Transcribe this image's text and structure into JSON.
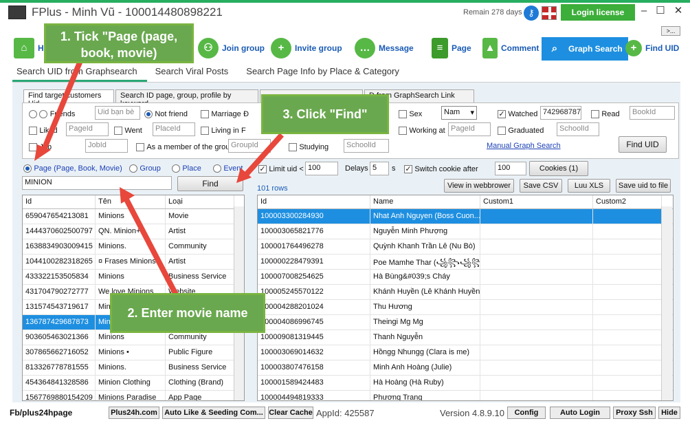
{
  "app": {
    "title": "FPlus - Minh Vũ - 100014480898221",
    "remain": "Remain 278 days",
    "login_label": "Login license",
    "expand_label": ">..."
  },
  "nav": [
    {
      "label": "H",
      "icon": "home-icon"
    },
    {
      "label": "Join group",
      "icon": "group-icon"
    },
    {
      "label": "Invite group",
      "icon": "invite-icon"
    },
    {
      "label": "Message",
      "icon": "message-icon"
    },
    {
      "label": "Page",
      "icon": "page-icon"
    },
    {
      "label": "Comment",
      "icon": "comment-icon"
    },
    {
      "label": "Graph Search",
      "icon": "search-icon"
    },
    {
      "label": "Find UID",
      "icon": "find-uid-icon"
    }
  ],
  "subtabs": [
    "Search UID from Graphsearch",
    "Search Viral Posts",
    "Search Page Info by Place & Category"
  ],
  "inner_tabs": [
    "Find target customers Uid",
    "Search ID page, group, profile by keyword",
    "",
    "D from GraphSearch Link"
  ],
  "options": {
    "friends": "Friends",
    "friends_input": "Uid bạn bè",
    "not_friend": "Not friend",
    "marriage": "Marriage",
    "marriage_prefix": "Đ",
    "sex": "Sex",
    "sex_value": "Nam",
    "watched": "Watched",
    "watched_input": "7429687873",
    "read": "Read",
    "read_input": "BookId",
    "liked": "Liked",
    "liked_input": "PageId",
    "went": "Went",
    "went_input": "PlaceId",
    "living": "Living in",
    "living_prefix": "F",
    "working": "Working at",
    "working_input": "PageId",
    "graduated": "Graduated",
    "graduated_input": "SchoolId",
    "job": "Job",
    "job_input": "JobId",
    "member": "As a member of the group",
    "member_input": "GroupId",
    "studying": "Studying",
    "studying_input": "SchoolId",
    "manual_link": "Manual Graph Search",
    "find_uid_btn": "Find UID"
  },
  "search": {
    "page_radio": "Page (Page, Book, Movie)",
    "group_radio": "Group",
    "place_radio": "Place",
    "event_radio": "Event",
    "keyword": "MINION",
    "find_btn": "Find"
  },
  "controls": {
    "limit_label": "Limit uid <",
    "limit": "100",
    "delays_label": "Delays",
    "delays": "5",
    "delays_unit": "s",
    "switch_label": "Switch cookie after",
    "switch": "100",
    "cookies_btn": "Cookies (1)",
    "rows": "101 rows",
    "view_btn": "View in webbrower",
    "savecsv_btn": "Save CSV",
    "luuxls_btn": "Luu XLS",
    "saveuid_btn": "Save uid to file"
  },
  "left_table": {
    "headers": [
      "Id",
      "Tên",
      "Loại"
    ],
    "rows": [
      [
        "659047654213081",
        "Minions",
        "Movie"
      ],
      [
        "1444370602500797",
        "QN. Minion+",
        "Artist"
      ],
      [
        "1638834903009415",
        "Minions.",
        "Community"
      ],
      [
        "1044100282318265",
        "¤ Frases Minions",
        "Artist"
      ],
      [
        "433322153505834",
        "Minions",
        "Business Service"
      ],
      [
        "431704790272777",
        "We love Minions",
        "Website"
      ],
      [
        "131574543719617",
        "Mini",
        "Community"
      ],
      [
        "136787429687873",
        "Mini",
        "Movie"
      ],
      [
        "903605463021366",
        "Minions",
        "Community"
      ],
      [
        "307865662716052",
        "Minions •",
        "Public Figure"
      ],
      [
        "813326778781555",
        "Minions.",
        "Business Service"
      ],
      [
        "454364841328586",
        "Minion Clothing",
        "Clothing (Brand)"
      ],
      [
        "1567769880154209",
        "Minions Paradise",
        "App Page"
      ]
    ]
  },
  "right_table": {
    "headers": [
      "Id",
      "Name",
      "Custom1",
      "Custom2"
    ],
    "rows": [
      [
        "100003300284930",
        "Nhat Anh Nguyen (Boss Cuon..."
      ],
      [
        "100003065821776",
        "Nguyễn Minh Phượng"
      ],
      [
        "100001764496278",
        "Quỳnh Khanh Trần Lê (Nu Bò)"
      ],
      [
        "100000228479391",
        "Poe Mamhe Thar (꧁꧂꧁꧂)"
      ],
      [
        "100007008254625",
        "Hà Bùng&#039;s Cháy"
      ],
      [
        "100005245570122",
        "Khánh Huyền (Lê Khánh Huyền)"
      ],
      [
        "100004288201024",
        "Thu Hương"
      ],
      [
        "100004086996745",
        "Theingi Mg Mg"
      ],
      [
        "100009081319445",
        "Thanh Nguyễn"
      ],
      [
        "100003069014632",
        "Hồngg Nhungg (Clara is me)"
      ],
      [
        "100003807476158",
        "Minh Anh Hoàng (Julie)"
      ],
      [
        "100001589424483",
        "Hà Hoàng (Hà Ruby)"
      ],
      [
        "100004494819333",
        "Phương Trang"
      ]
    ]
  },
  "status": {
    "fb": "Fb/plus24hpage",
    "btn1": "Plus24h.com",
    "btn2": "Auto Like & Seeding Com...",
    "btn3": "Clear Cache",
    "appid": "AppId: 425587",
    "version": "Version 4.8.9.10",
    "config": "Config",
    "autologin": "Auto Login",
    "proxy": "Proxy Ssh",
    "hide": "Hide"
  },
  "callouts": {
    "c1": "1. Tick \"Page (page, book, movie)",
    "c2": "2. Enter movie name",
    "c3": "3. Click \"Find\""
  },
  "colors": {
    "accent": "#1e8fe0",
    "green": "#6aa84f",
    "arrow": "#e8473c"
  }
}
